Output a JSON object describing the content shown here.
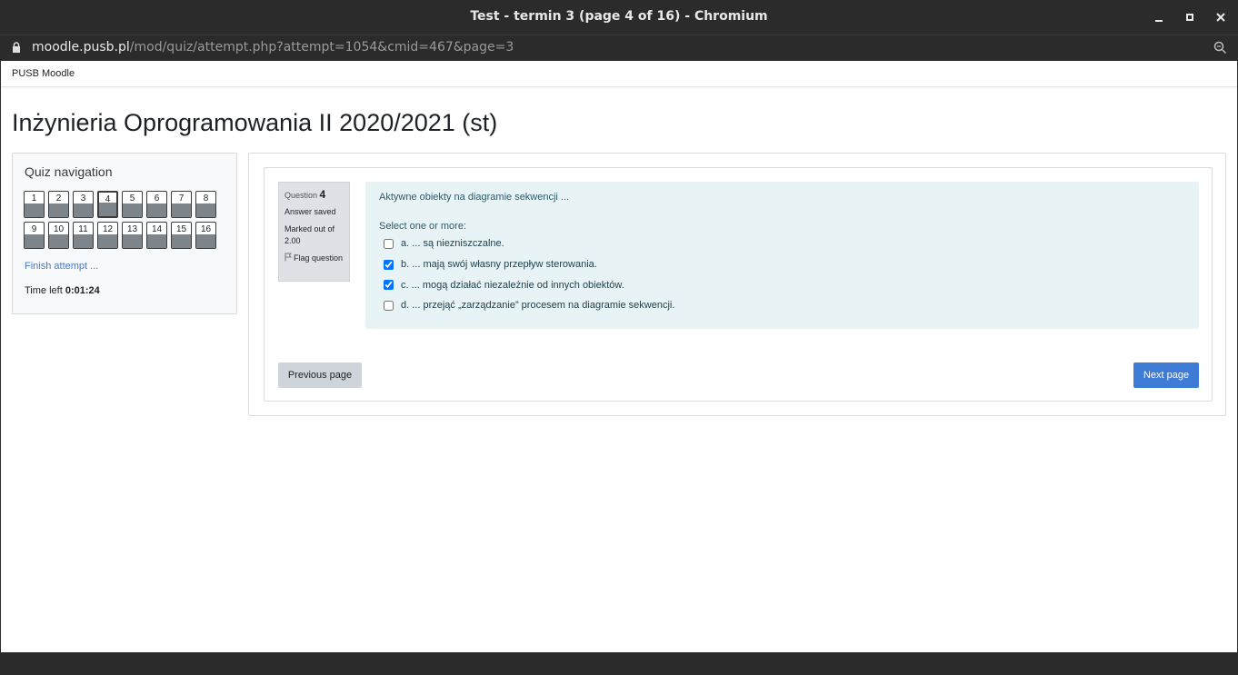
{
  "window": {
    "title": "Test - termin 3 (page 4 of 16) - Chromium"
  },
  "address": {
    "host": "moodle.pusb.pl",
    "path": "/mod/quiz/attempt.php?attempt=1054&cmid=467&page=3"
  },
  "site": {
    "brand": "PUSB Moodle"
  },
  "course": {
    "title": "Inżynieria Oprogramowania II 2020/2021 (st)"
  },
  "quiz_nav": {
    "title": "Quiz navigation",
    "questions": [
      "1",
      "2",
      "3",
      "4",
      "5",
      "6",
      "7",
      "8",
      "9",
      "10",
      "11",
      "12",
      "13",
      "14",
      "15",
      "16"
    ],
    "current": "4",
    "finish_label": "Finish attempt ...",
    "time_left_label": "Time left",
    "time_left_value": "0:01:24"
  },
  "question": {
    "label": "Question",
    "number": "4",
    "status": "Answer saved",
    "marked": "Marked out of 2.00",
    "flag_label": "Flag question",
    "text": "Aktywne obiekty na diagramie sekwencji ...",
    "prompt": "Select one or more:",
    "answers": [
      {
        "label": "a. ... są niezniszczalne.",
        "checked": false
      },
      {
        "label": "b. ... mają swój własny przepływ sterowania.",
        "checked": true
      },
      {
        "label": "c. ... mogą działać niezależnie od innych obiektów.",
        "checked": true
      },
      {
        "label": "d. ... przejąć „zarządzanie” procesem na diagramie sekwencji.",
        "checked": false
      }
    ]
  },
  "buttons": {
    "previous": "Previous page",
    "next": "Next page"
  },
  "colors": {
    "accent": "#3e7bd6",
    "link": "#4a7ac2",
    "question_bg": "#e7f3f5"
  }
}
